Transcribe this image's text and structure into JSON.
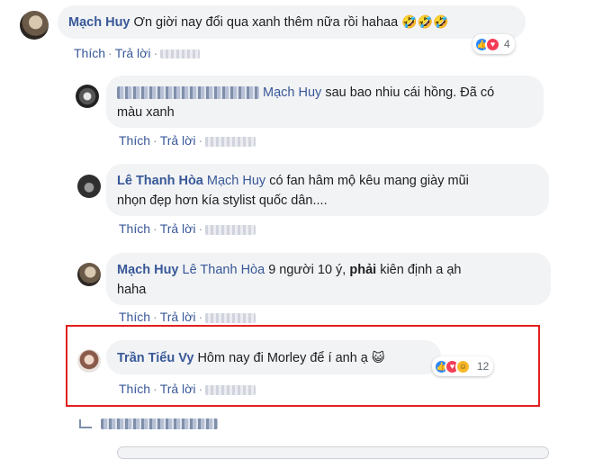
{
  "comments": [
    {
      "author": "Mạch Huy",
      "text": "Ơn giời nay đổi qua xanh thêm nữa rồi hahaa",
      "emoji": "🤣🤣🤣",
      "like_label": "Thích",
      "reply_label": "Trả lời",
      "reactions": {
        "types": [
          "like-icon",
          "love-icon"
        ],
        "count": "4"
      }
    },
    {
      "author": "",
      "tag": "Mạch Huy",
      "text": "sau bao nhiu cái hồng. Đã có",
      "text2": "màu xanh",
      "like_label": "Thích",
      "reply_label": "Trả lời"
    },
    {
      "author": "Lê Thanh Hòa",
      "tag": "Mạch Huy",
      "text": "có fan hâm mộ kêu mang giày mũi",
      "text2": "nhọn đẹp hơn kía stylist quốc dân....",
      "like_label": "Thích",
      "reply_label": "Trả lời"
    },
    {
      "author": "Mạch Huy",
      "tag": "Lê Thanh Hòa",
      "text": "9 người 10 ý,",
      "text_bold": "phải",
      "text_rest": "kiên định a ạh",
      "text2": "haha",
      "like_label": "Thích",
      "reply_label": "Trả lời"
    },
    {
      "author": "Trần Tiểu Vy",
      "text": "Hôm nay đi Morley để í anh ạ",
      "emoji": "😺",
      "like_label": "Thích",
      "reply_label": "Trả lời",
      "reactions": {
        "types": [
          "like-icon",
          "love-icon",
          "haha-icon"
        ],
        "count": "12"
      }
    }
  ],
  "colors": {
    "link": "#385898",
    "bubble": "#f2f3f5",
    "highlight": "#e0201f"
  }
}
